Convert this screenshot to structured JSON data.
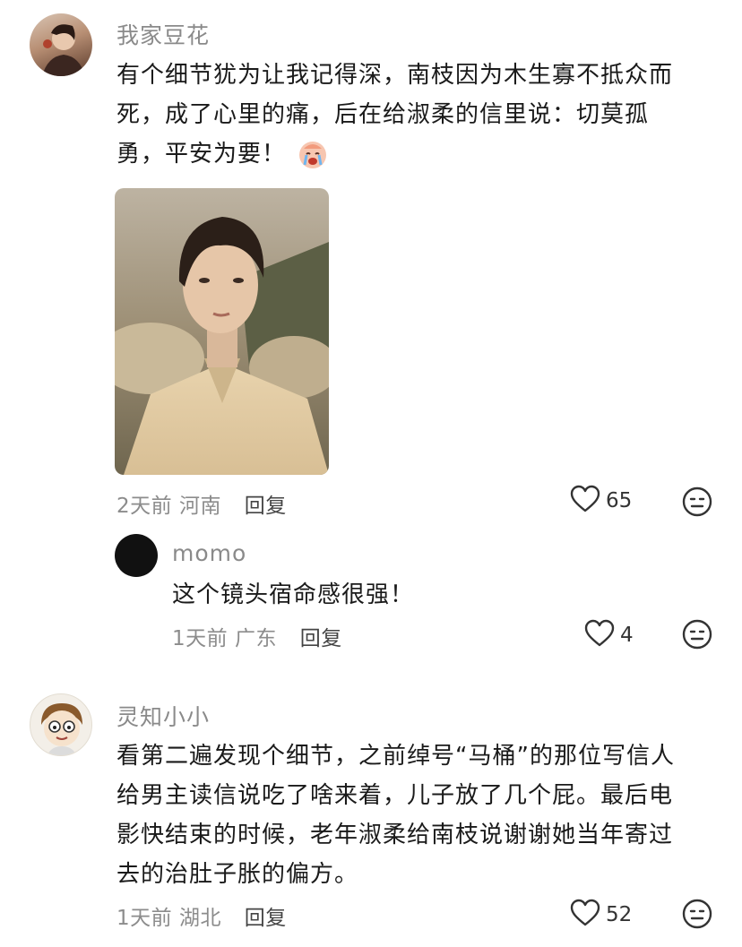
{
  "comments": [
    {
      "username": "我家豆花",
      "lines": [
        "有个细节犹为让我记得深，南枝因为木生寡不抵众而",
        "死，成了心里的痛，后在给淑柔的信里说：切莫孤",
        "勇，平安为要！"
      ],
      "emoji": "crying-face-emoji",
      "time": "2天前",
      "location": "河南",
      "reply_label": "回复",
      "likes": "65"
    },
    {
      "username": "momo",
      "lines": [
        "这个镜头宿命感很强！"
      ],
      "time": "1天前",
      "location": "广东",
      "reply_label": "回复",
      "likes": "4"
    },
    {
      "username": "灵知小小",
      "lines": [
        "看第二遍发现个细节，之前绰号“马桶”的那位写信人",
        "给男主读信说吃了啥来着，儿子放了几个屁。最后电",
        "影快结束的时候，老年淑柔给南枝说谢谢她当年寄过",
        "去的治肚子胀的偏方。"
      ],
      "time": "1天前",
      "location": "湖北",
      "reply_label": "回复",
      "likes": "52"
    }
  ],
  "icons": {
    "like": "heart-outline-icon",
    "dislike": "dislike-face-icon"
  },
  "colors": {
    "text": "#1a1a1a",
    "muted": "#8c8c8c",
    "username": "#8a8a8a"
  }
}
